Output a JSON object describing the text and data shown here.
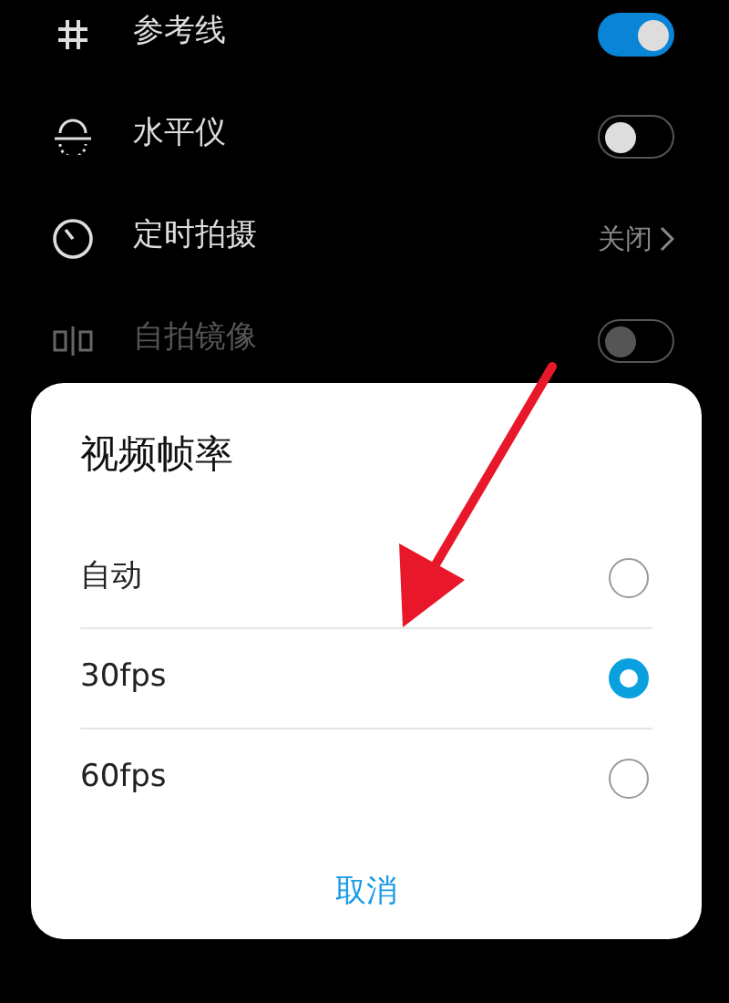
{
  "settings": [
    {
      "kind": "switch",
      "label": "参考线",
      "on": true,
      "disabled": false
    },
    {
      "kind": "switch",
      "label": "水平仪",
      "on": false,
      "disabled": false
    },
    {
      "kind": "link",
      "label": "定时拍摄",
      "value": "关闭",
      "disabled": false
    },
    {
      "kind": "switch",
      "label": "自拍镜像",
      "on": false,
      "disabled": true
    }
  ],
  "dialog": {
    "title": "视频帧率",
    "options": [
      {
        "label": "自动",
        "selected": false
      },
      {
        "label": "30fps",
        "selected": true
      },
      {
        "label": "60fps",
        "selected": false
      }
    ],
    "cancel": "取消"
  }
}
